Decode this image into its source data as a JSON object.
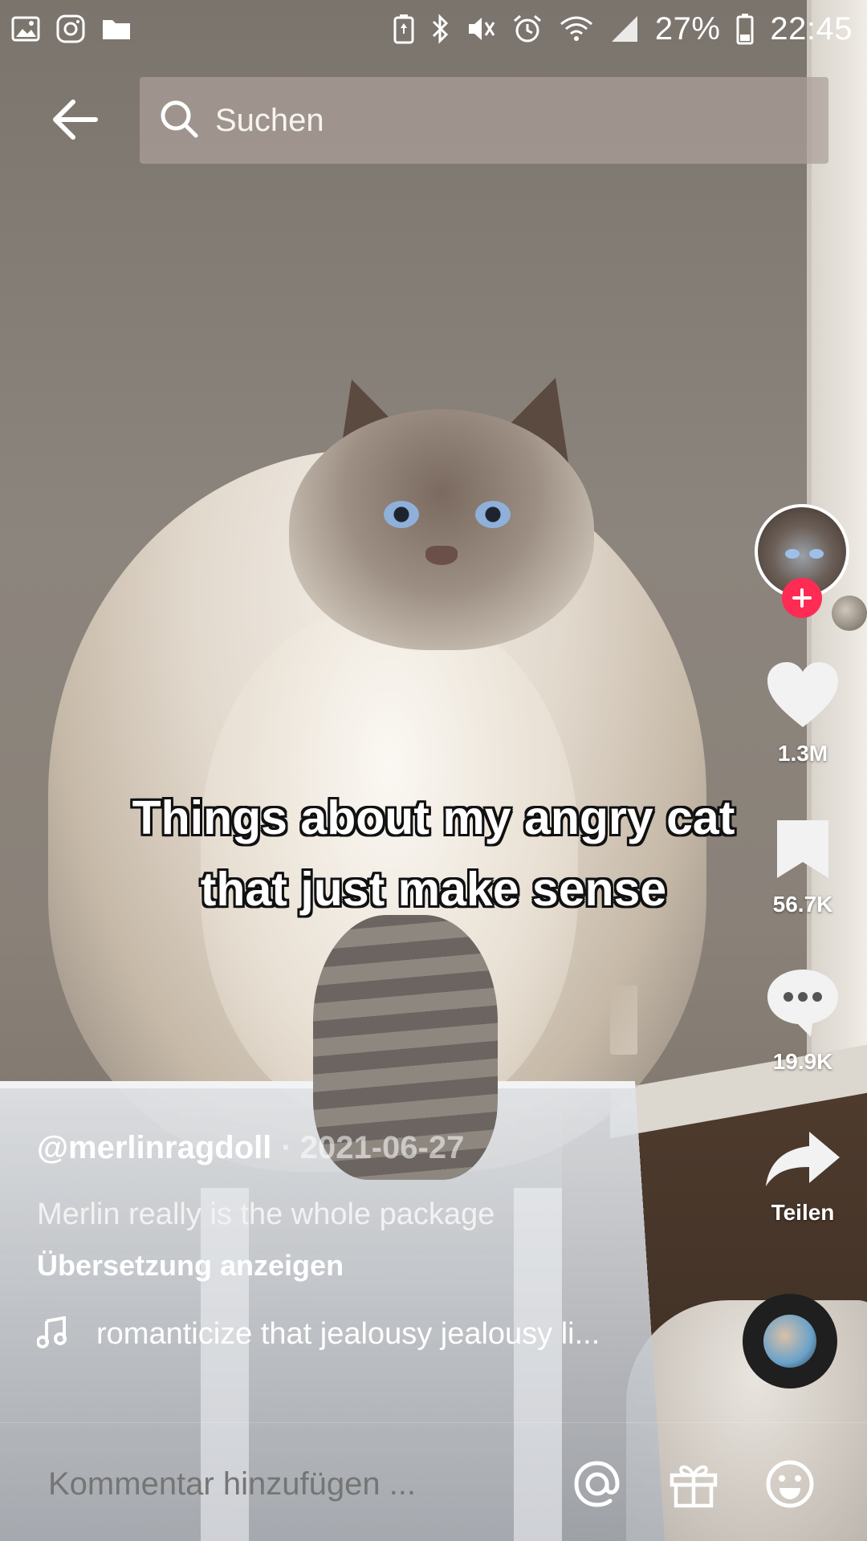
{
  "status_bar": {
    "left_icons": [
      "gallery-icon",
      "instagram-icon",
      "folder-icon"
    ],
    "right_icons": [
      "battery-saver-icon",
      "bluetooth-icon",
      "mute-icon",
      "alarm-icon",
      "wifi-icon",
      "signal-icon"
    ],
    "battery_percent": "27%",
    "time": "22:45"
  },
  "header": {
    "back_icon": "arrow-left-icon",
    "search_placeholder": "Suchen"
  },
  "video": {
    "caption_line1": "Things about my angry cat",
    "caption_line2": "that just make sense"
  },
  "actions": {
    "likes": "1.3M",
    "favorites": "56.7K",
    "comments": "19.9K",
    "share_label": "Teilen",
    "like_icon": "heart-icon",
    "favorite_icon": "bookmark-icon",
    "comment_icon": "comment-bubble-icon",
    "share_icon": "share-arrow-icon",
    "follow_icon": "plus-icon"
  },
  "post": {
    "username": "@merlinragdoll",
    "separator": "·",
    "date": "2021-06-27",
    "description": "Merlin really is the whole package",
    "translate_label": "Übersetzung anzeigen",
    "music_title": "romanticize that jealousy jealousy li..."
  },
  "comment_bar": {
    "placeholder": "Kommentar hinzufügen ...",
    "icons": [
      "mention-icon",
      "gift-icon",
      "emoji-icon"
    ]
  },
  "colors": {
    "follow_accent": "#fe2c55",
    "search_background": "#aaa098"
  }
}
